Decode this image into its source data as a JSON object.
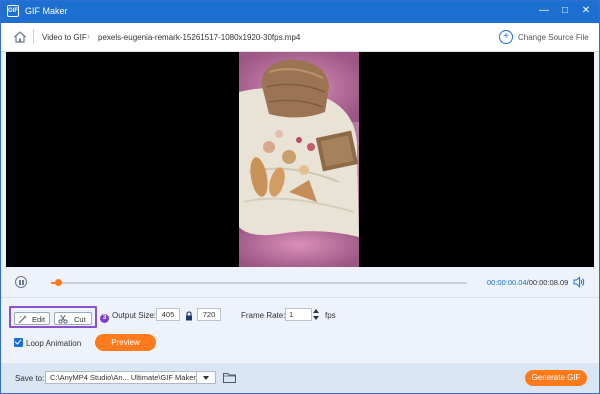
{
  "window": {
    "app_icon_text": "GIF",
    "title": "GIF Maker",
    "controls": [
      "—",
      "□",
      "✕"
    ],
    "accent_color": "#1e6fd2",
    "orange_color": "#ff7a1a"
  },
  "breadcrumb": {
    "section": "Video to GIF",
    "file": "pexels-eugenia-remark-15261517-1080x1920-30fps.mp4",
    "change_source": "Change Source File"
  },
  "player": {
    "current_time": "00:00:00.04",
    "total_time": "/00:00:08.09",
    "progress": 0.018
  },
  "tools": {
    "edit_label": "Edit",
    "cut_label": "Cut",
    "badge_number": "3"
  },
  "output": {
    "size_label": "Output Size:",
    "width": "405",
    "height": "720",
    "frame_rate_label": "Frame Rate:",
    "frame_rate": "1",
    "fps_label": "fps"
  },
  "options": {
    "loop_label": "Loop Animation",
    "loop_checked": true,
    "preview_label": "Preview"
  },
  "footer": {
    "save_to_label": "Save to:",
    "path": "C:\\AnyMP4 Studio\\An... Ultimate\\GIF Maker",
    "generate_label": "Generate GIF"
  }
}
